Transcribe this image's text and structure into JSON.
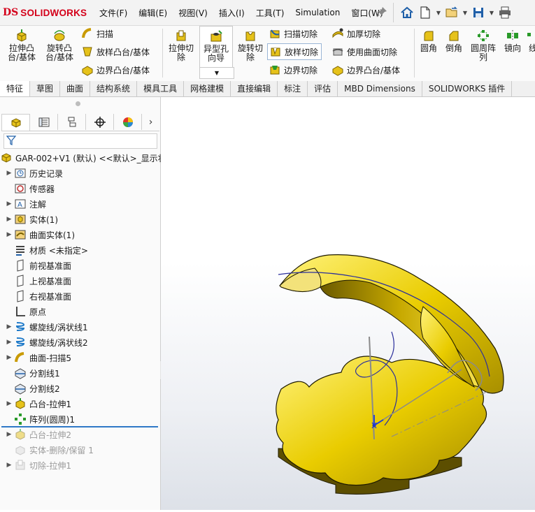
{
  "app": {
    "logo_ds": "DS",
    "logo_word": "SOLIDWORKS"
  },
  "menu": [
    "文件(F)",
    "编辑(E)",
    "视图(V)",
    "插入(I)",
    "工具(T)",
    "Simulation",
    "窗口(W)"
  ],
  "ribbon": {
    "extrude_boss": "拉伸凸\n台/基体",
    "revolve_boss": "旋转凸\n台/基体",
    "sweep": "扫描",
    "loft_boss": "放样凸台/基体",
    "boundary_boss": "边界凸台/基体",
    "extrude_cut": "拉伸切\n除",
    "hole_wizard": "异型孔\n向导",
    "revolve_cut": "旋转切\n除",
    "sweep_cut": "扫描切除",
    "loft_cut": "放样切除",
    "boundary_cut": "边界切除",
    "thicken_cut": "加厚切除",
    "surface_cut": "使用曲面切除",
    "boundary_boss2": "边界凸台/基体",
    "fillet": "圆角",
    "chamfer": "倒角",
    "circular_pattern": "圆周阵\n列",
    "mirror": "镜向",
    "more": "线"
  },
  "tabs": [
    "特征",
    "草图",
    "曲面",
    "结构系统",
    "模具工具",
    "网格建模",
    "直接编辑",
    "标注",
    "评估",
    "MBD Dimensions",
    "SOLIDWORKS 插件"
  ],
  "active_tab": "特征",
  "tree": {
    "root": "GAR-002+V1 (默认) <<默认>_显示状",
    "items": [
      {
        "label": "历史记录",
        "icon": "history-icon",
        "expand": true,
        "grey": false
      },
      {
        "label": "传感器",
        "icon": "sensor-icon",
        "expand": false,
        "grey": false
      },
      {
        "label": "注解",
        "icon": "annotation-icon",
        "expand": true,
        "grey": false
      },
      {
        "label": "实体(1)",
        "icon": "solid-bodies-icon",
        "expand": true,
        "grey": false
      },
      {
        "label": "曲面实体(1)",
        "icon": "surface-bodies-icon",
        "expand": true,
        "grey": false
      },
      {
        "label": "材质 <未指定>",
        "icon": "material-icon",
        "expand": false,
        "grey": false
      },
      {
        "label": "前视基准面",
        "icon": "plane-icon",
        "expand": false,
        "grey": false
      },
      {
        "label": "上视基准面",
        "icon": "plane-icon",
        "expand": false,
        "grey": false
      },
      {
        "label": "右视基准面",
        "icon": "plane-icon",
        "expand": false,
        "grey": false
      },
      {
        "label": "原点",
        "icon": "origin-icon",
        "expand": false,
        "grey": false
      },
      {
        "label": "螺旋线/涡状线1",
        "icon": "helix-icon",
        "expand": true,
        "grey": false
      },
      {
        "label": "螺旋线/涡状线2",
        "icon": "helix-icon",
        "expand": true,
        "grey": false
      },
      {
        "label": "曲面-扫描5",
        "icon": "surface-sweep-icon",
        "expand": true,
        "grey": false
      },
      {
        "label": "分割线1",
        "icon": "split-line-icon",
        "expand": false,
        "grey": false
      },
      {
        "label": "分割线2",
        "icon": "split-line-icon",
        "expand": false,
        "grey": false
      },
      {
        "label": "凸台-拉伸1",
        "icon": "boss-extrude-icon",
        "expand": true,
        "grey": false
      },
      {
        "label": "阵列(圆周)1",
        "icon": "circular-pattern-icon",
        "expand": false,
        "grey": false
      },
      {
        "label": "凸台-拉伸2",
        "icon": "boss-extrude-icon",
        "expand": true,
        "grey": true
      },
      {
        "label": "实体-删除/保留 1",
        "icon": "delete-body-icon",
        "expand": false,
        "grey": true
      },
      {
        "label": "切除-拉伸1",
        "icon": "cut-extrude-icon",
        "expand": true,
        "grey": true
      }
    ]
  },
  "colors": {
    "accent_red": "#d4001a",
    "part_yellow": "#e8c800",
    "rollback_blue": "#2e78c7"
  }
}
